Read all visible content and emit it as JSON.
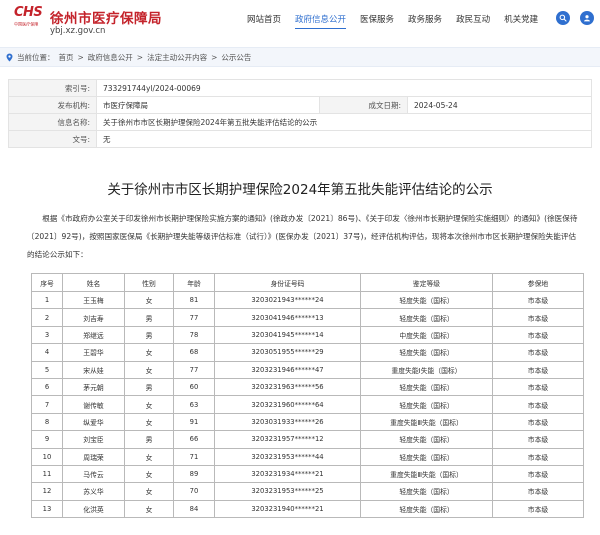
{
  "header": {
    "logo_mark": "CHS",
    "logo_sub": "中国医疗保障",
    "site_name": "徐州市医疗保障局",
    "site_url": "ybj.xz.gov.cn",
    "nav": [
      {
        "label": "网站首页",
        "active": false
      },
      {
        "label": "政府信息公开",
        "active": true
      },
      {
        "label": "医保服务",
        "active": false
      },
      {
        "label": "政务服务",
        "active": false
      },
      {
        "label": "政民互动",
        "active": false
      },
      {
        "label": "机关党建",
        "active": false
      }
    ],
    "icons": [
      "search-icon",
      "user-icon"
    ],
    "accent_color": "#2f6fcf",
    "brand_color": "#c4232b"
  },
  "breadcrumb": {
    "prefix": "当前位置：",
    "items": [
      "首页",
      "政府信息公开",
      "法定主动公开内容",
      "公示公告"
    ],
    "separator": ">"
  },
  "info": {
    "index_label": "索引号:",
    "index_value": "733291744yl/2024-00069",
    "org_label": "发布机构:",
    "org_value": "市医疗保障局",
    "date_label": "成文日期:",
    "date_value": "2024-05-24",
    "name_label": "信息名称:",
    "name_value": "关于徐州市市区长期护理保险2024年第五批失能评估结论的公示",
    "doc_label": "文号:",
    "doc_value": "无"
  },
  "article": {
    "title": "关于徐州市市区长期护理保险2024年第五批失能评估结论的公示",
    "paragraph": "根据《市政府办公室关于印发徐州市长期护理保险实施方案的通知》(徐政办发〔2021〕86号)、《关于印发〈徐州市长期护理保险实施细则〉的通知》(徐医保待〔2021〕92号)，按照国家医保局《长期护理失能等级评估标准（试行）》(医保办发〔2021〕37号)，经评估机构评估，现将本次徐州市市区长期护理保险失能评估的结论公示如下："
  },
  "table": {
    "headers": [
      "序号",
      "姓名",
      "性别",
      "年龄",
      "身份证号码",
      "鉴定等级",
      "参保地"
    ],
    "rows": [
      [
        "1",
        "王玉梅",
        "女",
        "81",
        "3203021943******24",
        "轻度失能（国标）",
        "市本级"
      ],
      [
        "2",
        "刘吉寿",
        "男",
        "77",
        "3203041946******13",
        "轻度失能（国标）",
        "市本级"
      ],
      [
        "3",
        "郑继远",
        "男",
        "78",
        "3203041945******14",
        "中度失能（国标）",
        "市本级"
      ],
      [
        "4",
        "王碧华",
        "女",
        "68",
        "3203051955******29",
        "轻度失能（国标）",
        "市本级"
      ],
      [
        "5",
        "宋从娃",
        "女",
        "77",
        "3203231946******47",
        "重度失能Ⅰ失能（国标）",
        "市本级"
      ],
      [
        "6",
        "茅元朝",
        "男",
        "60",
        "3203231963******56",
        "轻度失能（国标）",
        "市本级"
      ],
      [
        "7",
        "谢传敏",
        "女",
        "63",
        "3203231960******64",
        "轻度失能（国标）",
        "市本级"
      ],
      [
        "8",
        "纵爱华",
        "女",
        "91",
        "3203031933******26",
        "重度失能Ⅲ失能（国标）",
        "市本级"
      ],
      [
        "9",
        "刘宝臣",
        "男",
        "66",
        "3203231957******12",
        "轻度失能（国标）",
        "市本级"
      ],
      [
        "10",
        "周瑞荣",
        "女",
        "71",
        "3203231953******44",
        "轻度失能（国标）",
        "市本级"
      ],
      [
        "11",
        "马传云",
        "女",
        "89",
        "3203231934******21",
        "重度失能Ⅲ失能（国标）",
        "市本级"
      ],
      [
        "12",
        "苏义华",
        "女",
        "70",
        "3203231953******25",
        "轻度失能（国标）",
        "市本级"
      ],
      [
        "13",
        "化洪英",
        "女",
        "84",
        "3203231940******21",
        "轻度失能（国标）",
        "市本级"
      ]
    ]
  }
}
